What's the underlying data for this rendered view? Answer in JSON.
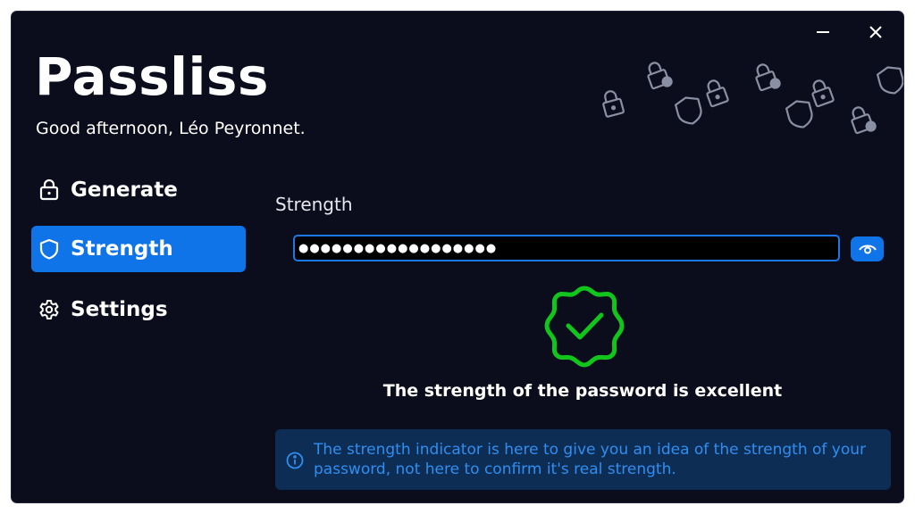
{
  "app": {
    "title": "Passliss",
    "greeting": "Good afternoon, Léo Peyronnet."
  },
  "titlebar": {
    "minimize_icon": "minimize-icon",
    "close_icon": "close-icon"
  },
  "nav": {
    "items": [
      {
        "label": "Generate",
        "icon": "lock-icon",
        "active": false
      },
      {
        "label": "Strength",
        "icon": "shield-icon",
        "active": true
      },
      {
        "label": "Settings",
        "icon": "gear-icon",
        "active": false
      }
    ]
  },
  "strength": {
    "section_title": "Strength",
    "password_masked": "●●●●●●●●●●●●●●●●●●",
    "result_text": "The strength of the password is excellent",
    "info_text": "The strength indicator is here to give you an idea of the strength of your password, not here to confirm it's real strength."
  },
  "colors": {
    "background": "#0b0d1c",
    "accent": "#0f74e8",
    "success": "#12c51c",
    "info_bg": "#0d2d55",
    "info_text": "#2f8ef0"
  }
}
